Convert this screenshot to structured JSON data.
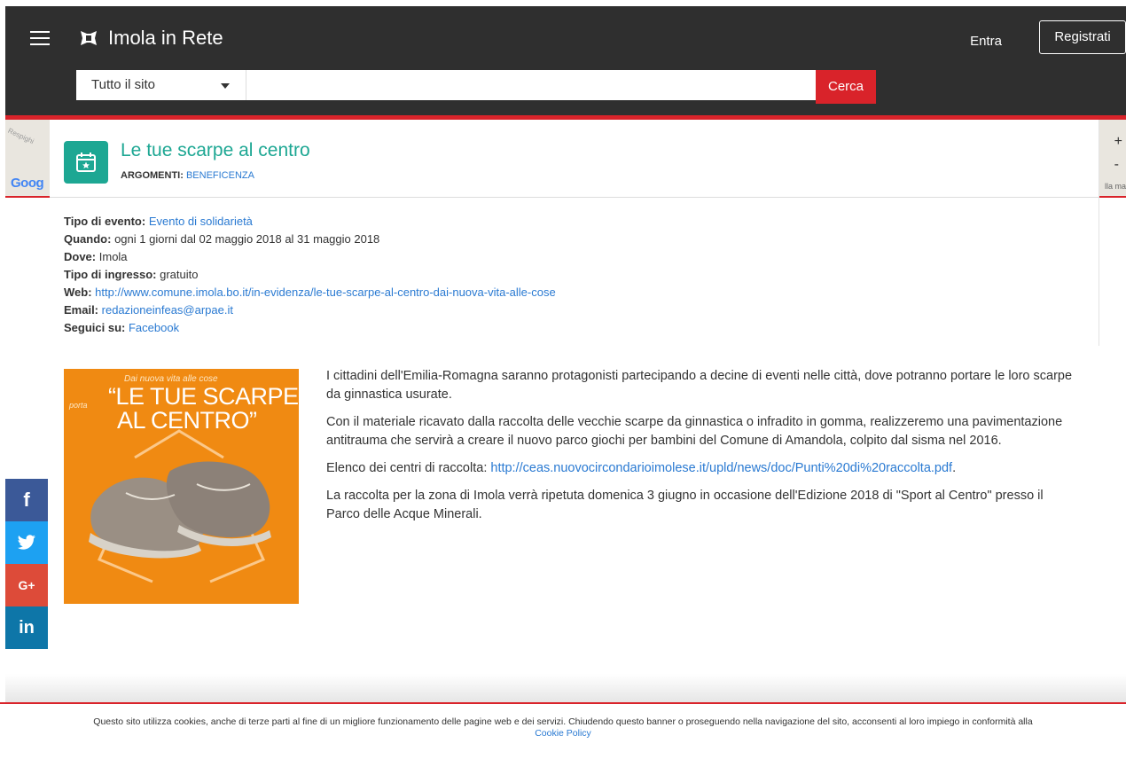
{
  "header": {
    "menu_icon": "hamburger-icon",
    "logo_icon": "imola-logo-icon",
    "site_name": "Imola in Rete",
    "login_label": "Entra",
    "register_label": "Registrati"
  },
  "search": {
    "scope_value": "Tutto il sito",
    "input_value": "",
    "button_label": "Cerca"
  },
  "map": {
    "street_label": "Respighi",
    "attribution": "Goog",
    "zoom_in": "+",
    "zoom_out": "-",
    "tail_text": "lla ma"
  },
  "event": {
    "icon": "calendar-star-icon",
    "title": "Le tue scarpe al centro",
    "topics_label": "ARGOMENTI:",
    "topics_value": "BENEFICENZA",
    "details": {
      "type_label": "Tipo di evento:",
      "type_value": "Evento di solidarietà",
      "when_label": "Quando:",
      "when_value": "ogni 1 giorni dal 02 maggio 2018 al 31 maggio 2018",
      "where_label": "Dove:",
      "where_value": "Imola",
      "entry_label": "Tipo di ingresso:",
      "entry_value": "gratuito",
      "web_label": "Web:",
      "web_value": "http://www.comune.imola.bo.it/in-evidenza/le-tue-scarpe-al-centro-dai-nuova-vita-alle-cose",
      "email_label": "Email:",
      "email_value": "redazioneinfeas@arpae.it",
      "follow_label": "Seguici su:",
      "follow_value": "Facebook"
    },
    "poster": {
      "tagline": "Dai nuova vita alle cose",
      "porta": "porta",
      "headline_line1": "“LE TUE SCARPE",
      "headline_line2": "AL CENTRO”"
    },
    "paragraphs": {
      "p1": "I cittadini dell'Emilia-Romagna saranno protagonisti partecipando a decine di eventi nelle città, dove potranno portare le loro scarpe da ginnastica usurate.",
      "p2": "Con il materiale ricavato dalla raccolta delle vecchie scarpe da ginnastica o infradito in gomma, realizzeremo una pavimentazione antitrauma che servirà a creare il nuovo parco giochi per bambini del Comune di Amandola, colpito dal sisma nel 2016.",
      "p3_prefix": "Elenco dei centri di raccolta:",
      "p3_link": "http://ceas.nuovocircondarioimolese.it/upld/news/doc/Punti%20di%20raccolta.pdf",
      "p3_suffix": ".",
      "p4": "La raccolta per la zona di Imola verrà ripetuta domenica 3 giugno in occasione dell'Edizione 2018 di \"Sport al Centro\" presso il Parco delle Acque Minerali."
    }
  },
  "social": {
    "facebook": "f",
    "twitter_icon": "twitter-icon",
    "googleplus": "G+",
    "linkedin": "in"
  },
  "cookie": {
    "text": "Questo sito utilizza cookies, anche di terze parti al fine di un migliore funzionamento delle pagine web e dei servizi. Chiudendo questo banner o proseguendo nella navigazione del sito, acconsenti al loro impiego in conformità alla",
    "link": "Cookie Policy"
  },
  "colors": {
    "header_bg": "#2f2f2f",
    "accent_red": "#d9232a",
    "event_teal": "#1da793",
    "link_blue": "#2a7ad2",
    "poster_orange": "#f08a12"
  }
}
